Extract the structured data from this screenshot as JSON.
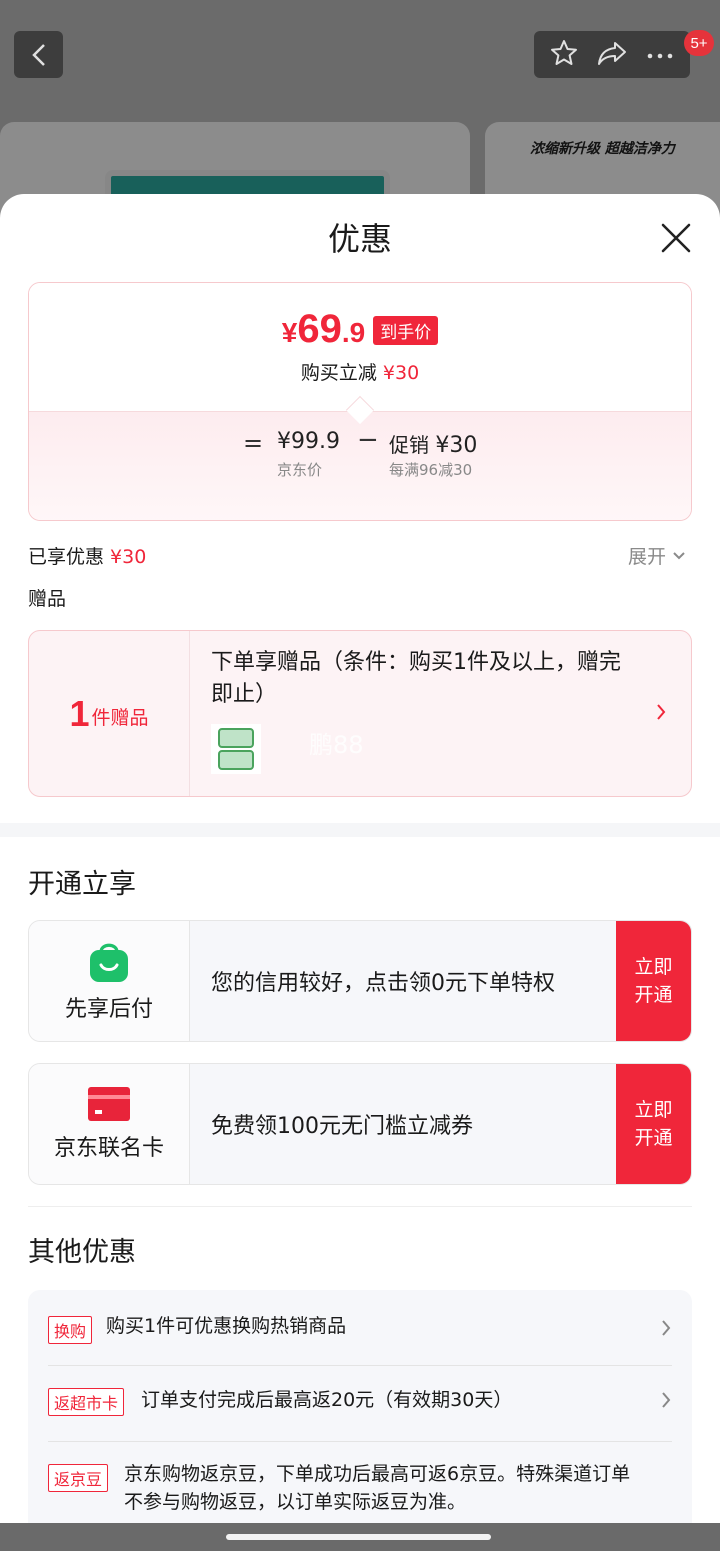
{
  "topbar": {
    "badge_count": "5+",
    "banner_text": "浓缩新升级 超越洁净力"
  },
  "sheet": {
    "title": "优惠"
  },
  "price_card": {
    "yen": "¥",
    "price_integer": "69",
    "price_decimal": ".9",
    "tag": "到手价",
    "subtitle_prefix": "购买立减",
    "subtitle_amount": "¥30",
    "equals": "=",
    "jd_price": "¥99.9",
    "jd_price_label": "京东价",
    "minus": "−",
    "promo_label": "促销",
    "promo_amount": "¥30",
    "promo_desc": "每满96减30"
  },
  "enjoyed": {
    "label": "已享优惠",
    "amount": "¥30",
    "expand_label": "展开"
  },
  "gift": {
    "heading": "赠品",
    "count": "1",
    "count_unit": "件赠品",
    "description": "下单享赠品（条件：购买1件及以上，赠完即止）",
    "watermark": "鹏88"
  },
  "open_section": {
    "heading": "开通立享",
    "cards": [
      {
        "label": "先享后付",
        "description": "您的信用较好，点击领0元下单特权",
        "button": "立即开通"
      },
      {
        "label": "京东联名卡",
        "description": "免费领100元无门槛立减券",
        "button": "立即开通"
      }
    ]
  },
  "other_section": {
    "heading": "其他优惠",
    "rows": [
      {
        "tag": "换购",
        "text": "购买1件可优惠换购热销商品"
      },
      {
        "tag": "返超市卡",
        "text": "订单支付完成后最高返20元（有效期30天）"
      },
      {
        "tag": "返京豆",
        "text": "京东购物返京豆，下单成功后最高可返6京豆。特殊渠道订单不参与购物返豆，以订单实际返豆为准。"
      }
    ]
  },
  "colors": {
    "accent_red": "#f0263a",
    "wallet_green": "#1ec06a",
    "card_red": "#e8243a"
  }
}
